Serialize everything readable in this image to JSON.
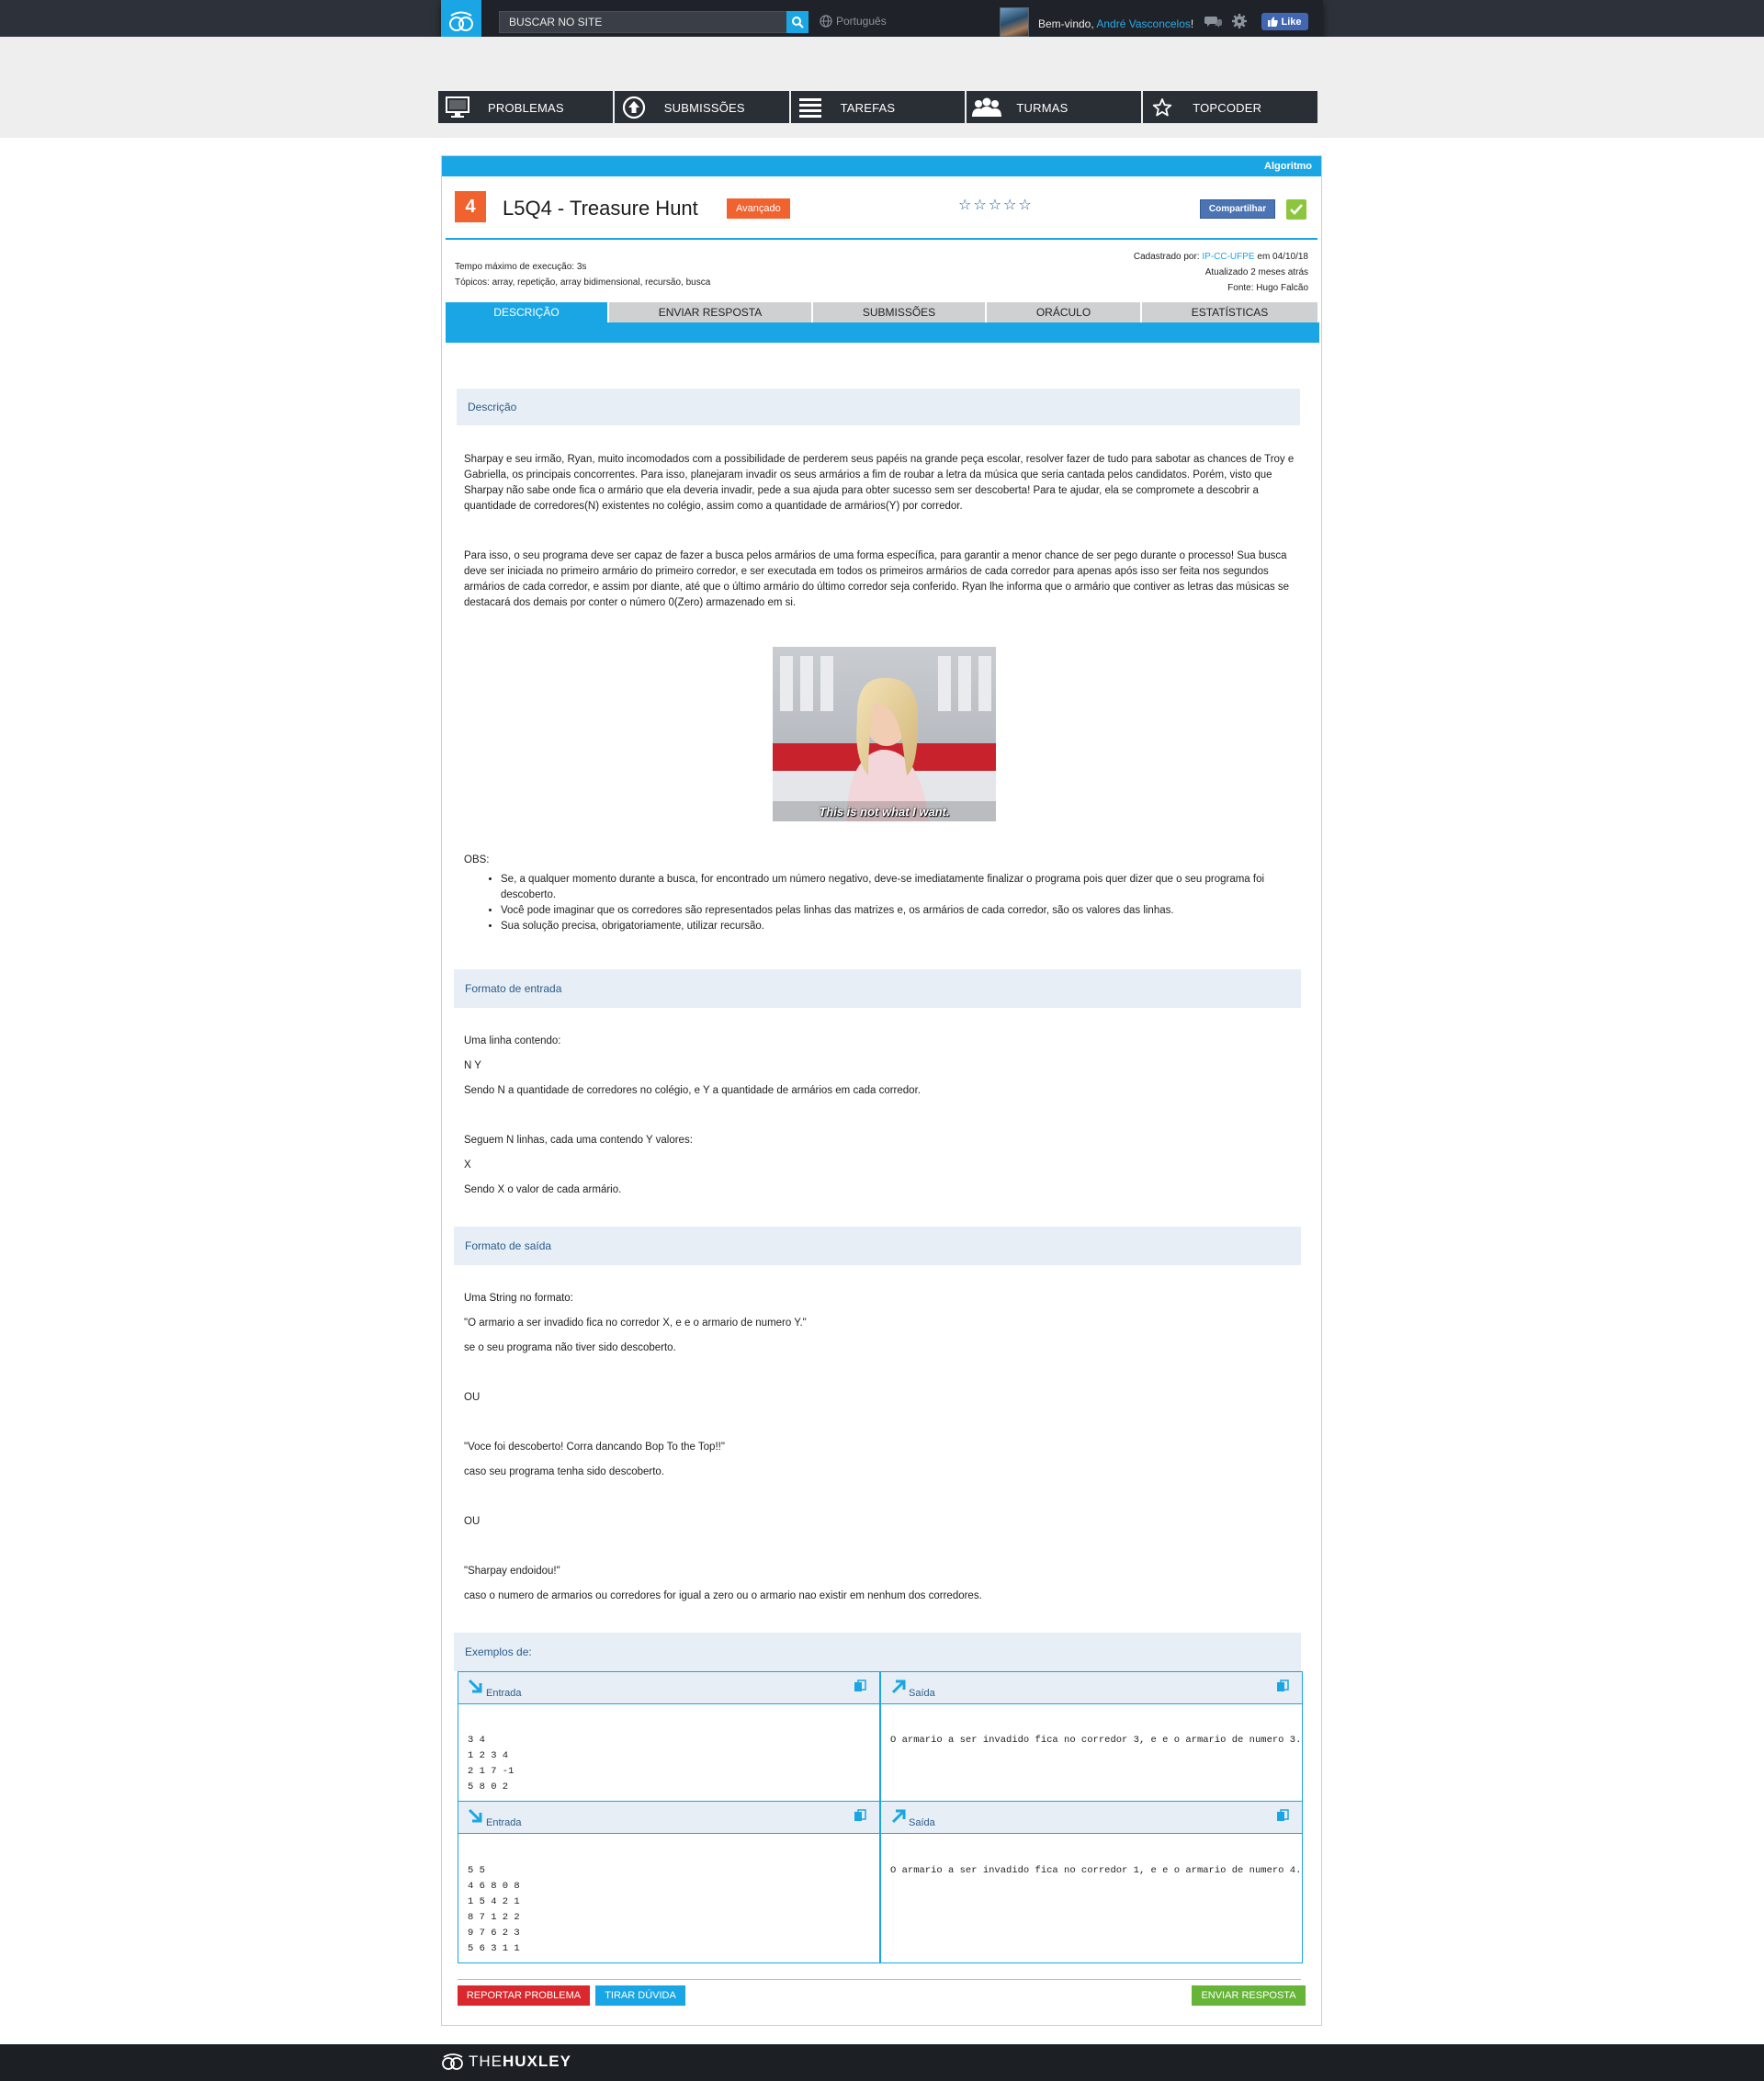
{
  "topbar": {
    "search_placeholder": "BUSCAR NO SITE",
    "language": "Português",
    "welcome_prefix": "Bem-vindo,",
    "user_name": "André Vasconcelos",
    "welcome_suffix": "!",
    "like_label": "Like",
    "icons": [
      "logo-icon",
      "search-icon",
      "globe-icon",
      "chat-icon",
      "gear-icon",
      "thumbs-up-icon"
    ]
  },
  "nav": {
    "items": [
      {
        "label": "PROBLEMAS",
        "icon": "monitor-icon"
      },
      {
        "label": "SUBMISSÕES",
        "icon": "upload-icon"
      },
      {
        "label": "TAREFAS",
        "icon": "list-icon"
      },
      {
        "label": "TURMAS",
        "icon": "users-icon"
      },
      {
        "label": "TOPCODER",
        "icon": "star-icon"
      }
    ]
  },
  "problem": {
    "category": "Algoritmo",
    "level": "4",
    "title": "L5Q4 - Treasure Hunt",
    "difficulty": "Avançado",
    "rating_stars": "☆☆☆☆☆",
    "share_label": "Compartilhar",
    "meta": {
      "time_limit": "Tempo máximo de execução: 3s",
      "topics": "Tópicos: array, repetição, array bidimensional, recursão, busca",
      "registered_prefix": "Cadastrado por:",
      "registered_by": "IP-CC-UFPE",
      "registered_date": "em 04/10/18",
      "updated": "Atualizado 2 meses atrás",
      "source": "Fonte: Hugo Falcão"
    }
  },
  "tabs": [
    {
      "label": "DESCRIÇÃO",
      "active": true
    },
    {
      "label": "ENVIAR RESPOSTA",
      "active": false
    },
    {
      "label": "SUBMISSÕES",
      "active": false
    },
    {
      "label": "ORÁCULO",
      "active": false
    },
    {
      "label": "ESTATÍSTICAS",
      "active": false
    }
  ],
  "description": {
    "heading": "Descrição",
    "p1": "Sharpay e seu irmão, Ryan, muito incomodados com a possibilidade de perderem seus papéis na grande peça escolar, resolver fazer de tudo para sabotar as chances de Troy e Gabriella, os principais concorrentes. Para isso, planejaram invadir os seus armários a fim de roubar a letra da música que seria cantada pelos candidatos. Porém, visto que Sharpay não sabe onde fica o armário que ela deveria invadir, pede a sua ajuda para obter sucesso sem ser descoberta! Para te ajudar, ela se compromete a descobrir a quantidade de corredores(N) existentes no colégio, assim como a quantidade de armários(Y) por corredor.",
    "p2": "Para isso, o seu programa deve ser capaz de fazer a busca pelos armários de uma forma específica, para garantir a menor chance de ser pego durante o processo! Sua busca deve ser iniciada no primeiro armário do primeiro corredor, e ser executada em todos os primeiros armários de cada corredor para apenas após isso ser feita nos segundos armários de cada corredor, e assim por diante, até que o último armário do último corredor  seja conferido. Ryan lhe informa que o armário que contiver as letras das músicas se destacará dos demais por conter o número 0(Zero) armazenado em si.",
    "gif_caption": "This is not what I want.",
    "obs_label": "OBS:",
    "obs": [
      "Se, a qualquer momento durante a busca, for encontrado um número negativo, deve-se imediatamente finalizar o programa pois quer dizer que o seu programa foi descoberto.",
      "Você pode imaginar que os corredores são representados pelas linhas das matrizes e, os armários de cada corredor, são os valores das linhas.",
      "Sua solução precisa, obrigatoriamente, utilizar recursão."
    ]
  },
  "input_format": {
    "heading": "Formato de entrada",
    "lines": [
      "Uma linha contendo:",
      "N Y",
      "Sendo N a quantidade de corredores no colégio, e Y a quantidade de armários em cada corredor.",
      "Seguem N linhas, cada uma contendo Y valores:",
      "X",
      "Sendo X o valor de cada armário."
    ]
  },
  "output_format": {
    "heading": "Formato de saída",
    "lines": [
      "Uma String no formato:",
      "\"O armario a ser invadido fica no corredor X, e e o armario de numero Y.\"",
      "se o seu programa não tiver sido descoberto.",
      "OU",
      "\"Voce foi descoberto! Corra dancando Bop To the Top!!\"",
      "caso seu programa tenha sido descoberto.",
      "OU",
      "\"Sharpay endoidou!\"",
      "caso o numero de armarios ou corredores for igual a zero ou o armario nao existir em nenhum dos corredores."
    ]
  },
  "examples": {
    "heading": "Exemplos de:",
    "input_label": "Entrada",
    "output_label": "Saída",
    "items": [
      {
        "input": "3 4\n1 2 3 4\n2 1 7 -1\n5 8 0 2",
        "output": "O armario a ser invadido fica no corredor 3, e e o armario de numero 3."
      },
      {
        "input": "5 5\n4 6 8 0 8\n1 5 4 2 1\n8 7 1 2 2\n9 7 6 2 3\n5 6 3 1 1",
        "output": "O armario a ser invadido fica no corredor 1, e e o armario de numero 4."
      }
    ]
  },
  "actions": {
    "report": "REPORTAR PROBLEMA",
    "doubt": "TIRAR DÚVIDA",
    "send": "ENVIAR RESPOSTA"
  },
  "footer": {
    "brand_thin": "THE",
    "brand_bold": "HUXLEY"
  },
  "colors": {
    "accent": "#1aa6e4",
    "level": "#f0622e",
    "success": "#66b438",
    "danger": "#d9282e",
    "topbar": "#2d323a"
  }
}
